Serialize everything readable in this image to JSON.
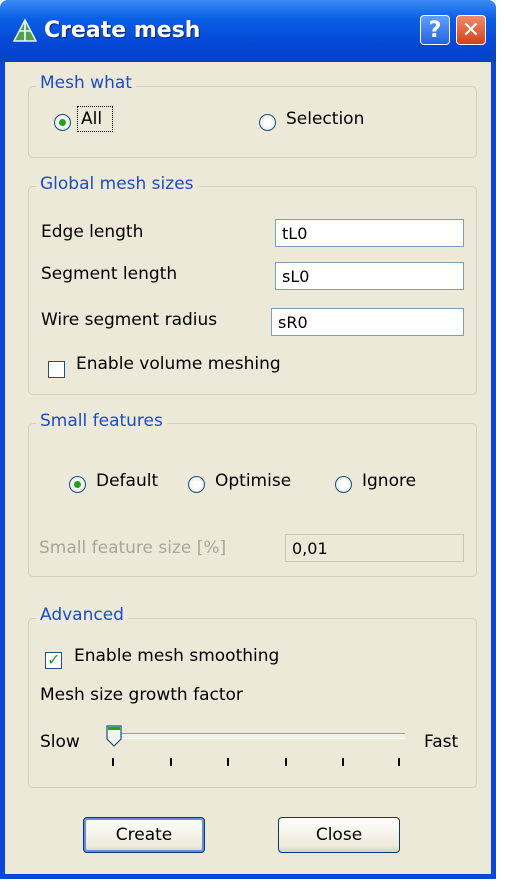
{
  "window": {
    "title": "Create mesh",
    "help_label": "?",
    "close_label": "✕"
  },
  "mesh_what": {
    "legend": "Mesh what",
    "options": [
      {
        "label": "All",
        "selected": true
      },
      {
        "label": "Selection",
        "selected": false
      }
    ]
  },
  "global_sizes": {
    "legend": "Global mesh sizes",
    "edge_length": {
      "label": "Edge length",
      "value": "tL0"
    },
    "segment_length": {
      "label": "Segment length",
      "value": "sL0"
    },
    "wire_radius": {
      "label": "Wire segment radius",
      "value": "sR0"
    },
    "volume_meshing": {
      "label": "Enable volume meshing",
      "checked": false
    }
  },
  "small_features": {
    "legend": "Small features",
    "options": [
      {
        "label": "Default",
        "selected": true
      },
      {
        "label": "Optimise",
        "selected": false
      },
      {
        "label": "Ignore",
        "selected": false
      }
    ],
    "size_label": "Small feature size [%]",
    "size_value": "0,01"
  },
  "advanced": {
    "legend": "Advanced",
    "smoothing": {
      "label": "Enable mesh smoothing",
      "checked": true
    },
    "growth_label": "Mesh size growth factor",
    "slow_label": "Slow",
    "fast_label": "Fast",
    "slider_position": 0
  },
  "buttons": {
    "create": "Create",
    "close": "Close"
  },
  "colors": {
    "titlebar": "#0a5ee6",
    "client": "#ece9d8",
    "legend_text": "#1c4cc8",
    "check_green": "#21a121"
  }
}
